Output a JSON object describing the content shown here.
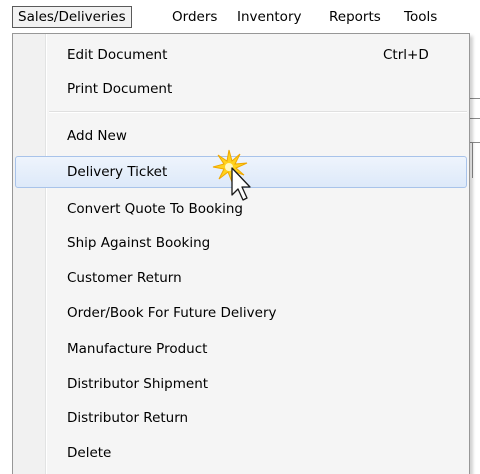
{
  "menubar": {
    "items": [
      {
        "label": "Sales/Deliveries"
      },
      {
        "label": "Orders"
      },
      {
        "label": "Inventory"
      },
      {
        "label": "Reports"
      },
      {
        "label": "Tools"
      }
    ]
  },
  "menu": {
    "items": [
      {
        "label": "Edit Document",
        "shortcut": "Ctrl+D"
      },
      {
        "label": "Print Document"
      },
      {
        "label": "Add New"
      },
      {
        "label": "Delivery Ticket"
      },
      {
        "label": "Convert Quote To Booking"
      },
      {
        "label": "Ship Against Booking"
      },
      {
        "label": "Customer Return"
      },
      {
        "label": "Order/Book For Future Delivery"
      },
      {
        "label": "Manufacture Product"
      },
      {
        "label": "Distributor Shipment"
      },
      {
        "label": "Distributor Return"
      },
      {
        "label": "Delete"
      }
    ]
  },
  "colors": {
    "hover_background": "#dde9f9",
    "hover_border": "#a8c3ea",
    "menu_background": "#f5f5f5",
    "click_burst": "#ffd21e"
  },
  "icons": [
    "mouse-pointer-icon",
    "click-burst-icon"
  ]
}
